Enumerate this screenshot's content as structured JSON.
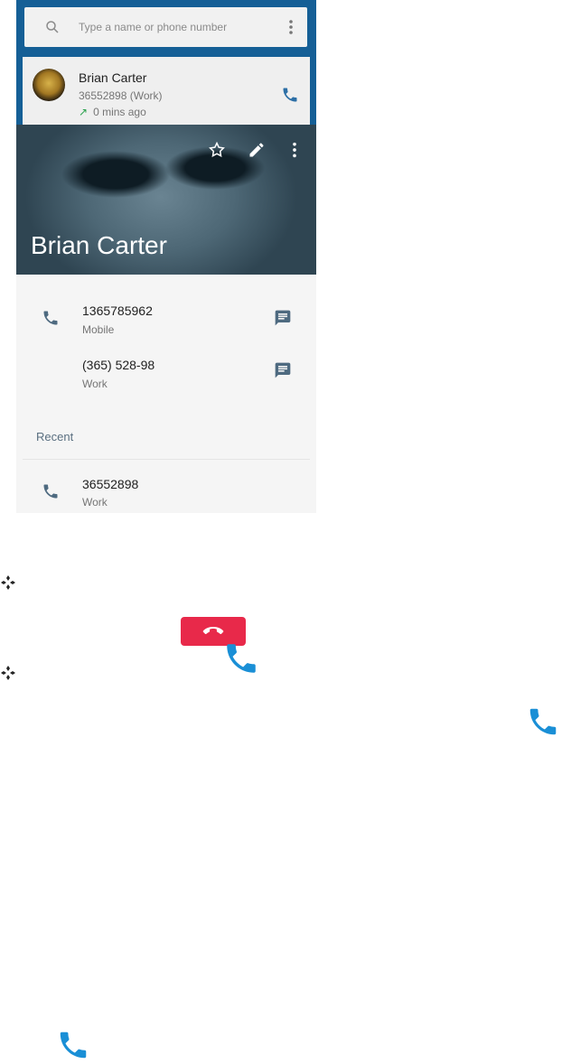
{
  "search": {
    "placeholder": "Type a name or phone number"
  },
  "recent_call": {
    "name": "Brian Carter",
    "number": "36552898 (Work)",
    "time_arrow": "↗",
    "time": "0 mins ago"
  },
  "contact": {
    "name": "Brian Carter",
    "phones": [
      {
        "number": "1365785962",
        "type": "Mobile"
      },
      {
        "number": "(365) 528-98",
        "type": "Work"
      }
    ],
    "recent_label": "Recent",
    "recent": [
      {
        "number": "36552898",
        "type": "Work"
      }
    ]
  },
  "icons": {
    "phone_color": "#1a8fd6",
    "end_call_color": "#e8294a",
    "header_blue": "#155f96"
  }
}
